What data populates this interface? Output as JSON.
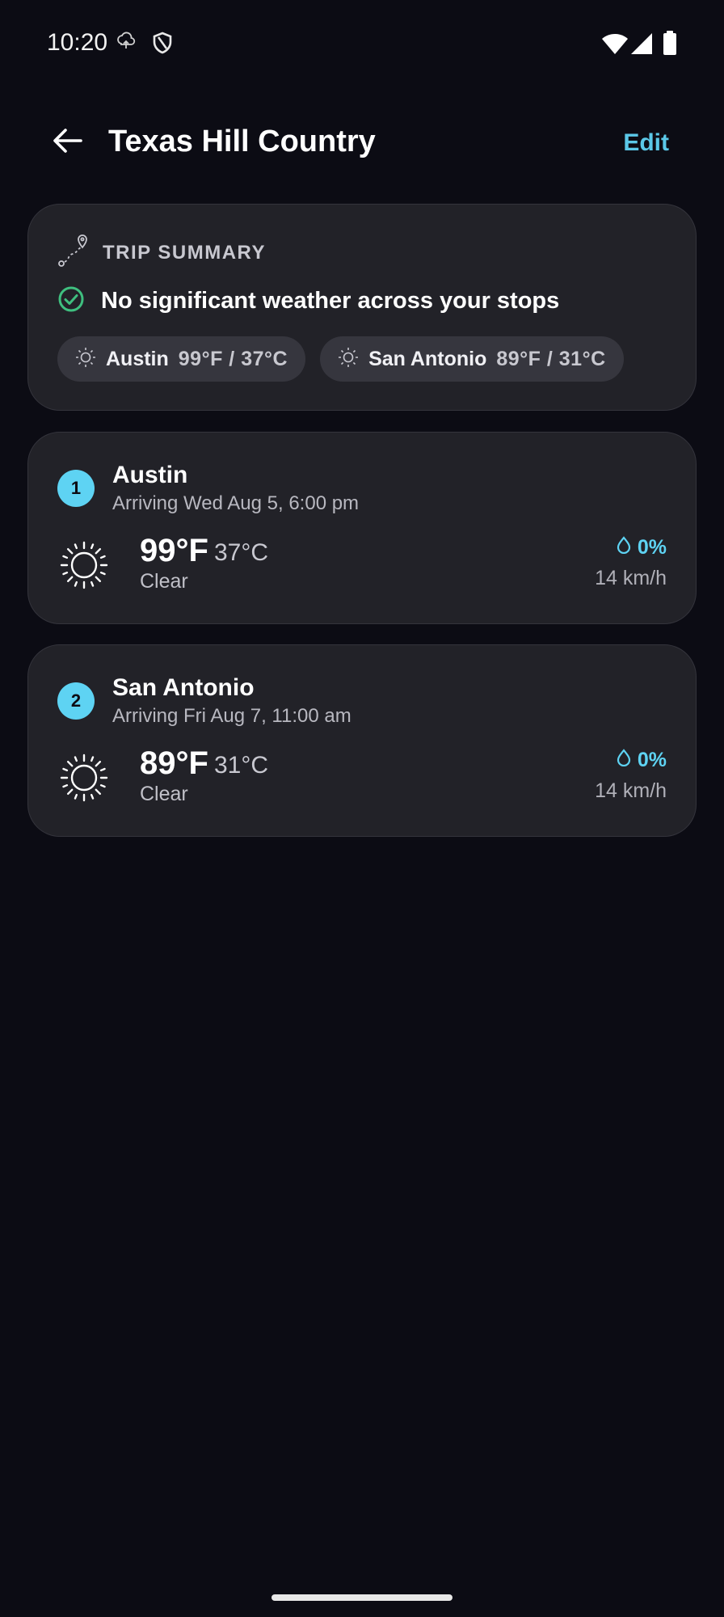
{
  "status_bar": {
    "time": "10:20"
  },
  "header": {
    "title": "Texas Hill Country",
    "edit_label": "Edit"
  },
  "summary": {
    "label": "TRIP SUMMARY",
    "status_text": "No significant weather across your stops",
    "chips": [
      {
        "city": "Austin",
        "temp": "99°F / 37°C",
        "icon": "sun-icon"
      },
      {
        "city": "San Antonio",
        "temp": "89°F / 31°C",
        "icon": "sun-icon"
      }
    ]
  },
  "stops": [
    {
      "number": "1",
      "name": "Austin",
      "arrival": "Arriving Wed Aug 5, 6:00 pm",
      "temp_f": "99°F",
      "temp_c": "37°C",
      "condition": "Clear",
      "precip": "0%",
      "wind": "14 km/h",
      "icon": "sun-icon"
    },
    {
      "number": "2",
      "name": "San Antonio",
      "arrival": "Arriving Fri Aug 7, 11:00 am",
      "temp_f": "89°F",
      "temp_c": "31°C",
      "condition": "Clear",
      "precip": "0%",
      "wind": "14 km/h",
      "icon": "sun-icon"
    }
  ],
  "colors": {
    "background": "#0c0c14",
    "card": "#222228",
    "accent": "#5ed3f3",
    "success": "#3fbf7f"
  }
}
